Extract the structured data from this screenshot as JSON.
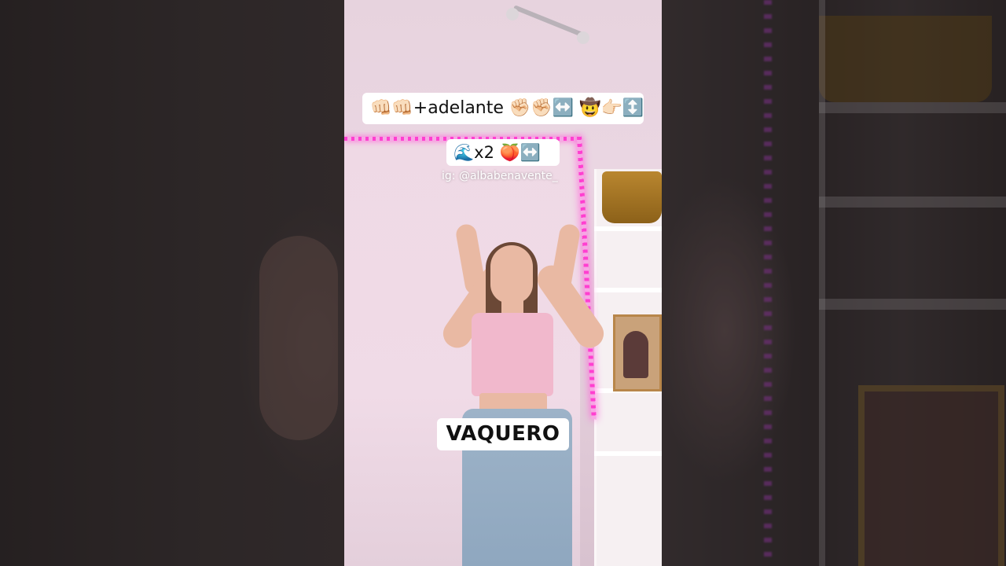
{
  "video": {
    "caption_line_1": "👊🏻👊🏻+adelante   ✊🏻✊🏻↔️   🤠👉🏻↕️",
    "caption_line_2": "🌊x2   🍑↔️",
    "credit": "ig: @albabenavente_",
    "move_label": "VAQUERO"
  },
  "colors": {
    "led": "#ff3fd0",
    "wall": "#ecd6e2",
    "caption_bg": "#ffffff",
    "caption_text": "#111111"
  }
}
